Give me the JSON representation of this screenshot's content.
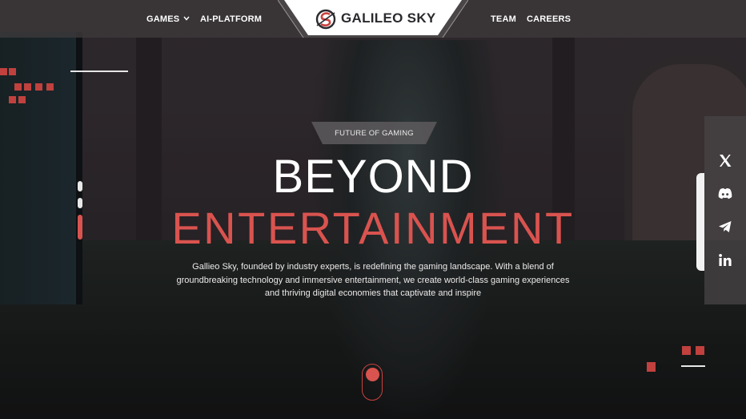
{
  "nav": {
    "left": [
      {
        "label": "GAMES",
        "has_dropdown": true
      },
      {
        "label": "AI-PLATFORM",
        "has_dropdown": false
      }
    ],
    "right": [
      {
        "label": "TEAM"
      },
      {
        "label": "CAREERS"
      }
    ],
    "logo_text": "GALILEO SKY"
  },
  "hero": {
    "tag": "FUTURE OF GAMING",
    "headline_line1": "BEYOND",
    "headline_line2": "ENTERTAINMENT",
    "description": "Gallieo Sky, founded by industry experts, is redefining the gaming landscape. With a blend of groundbreaking technology and immersive entertainment, we create world-class gaming experiences and thriving digital economies that captivate and inspire"
  },
  "social": [
    {
      "name": "x-icon"
    },
    {
      "name": "discord-icon"
    },
    {
      "name": "telegram-icon"
    },
    {
      "name": "linkedin-icon"
    }
  ],
  "colors": {
    "accent": "#d9534f",
    "header_bg": "#3c383a",
    "text": "#ffffff"
  }
}
